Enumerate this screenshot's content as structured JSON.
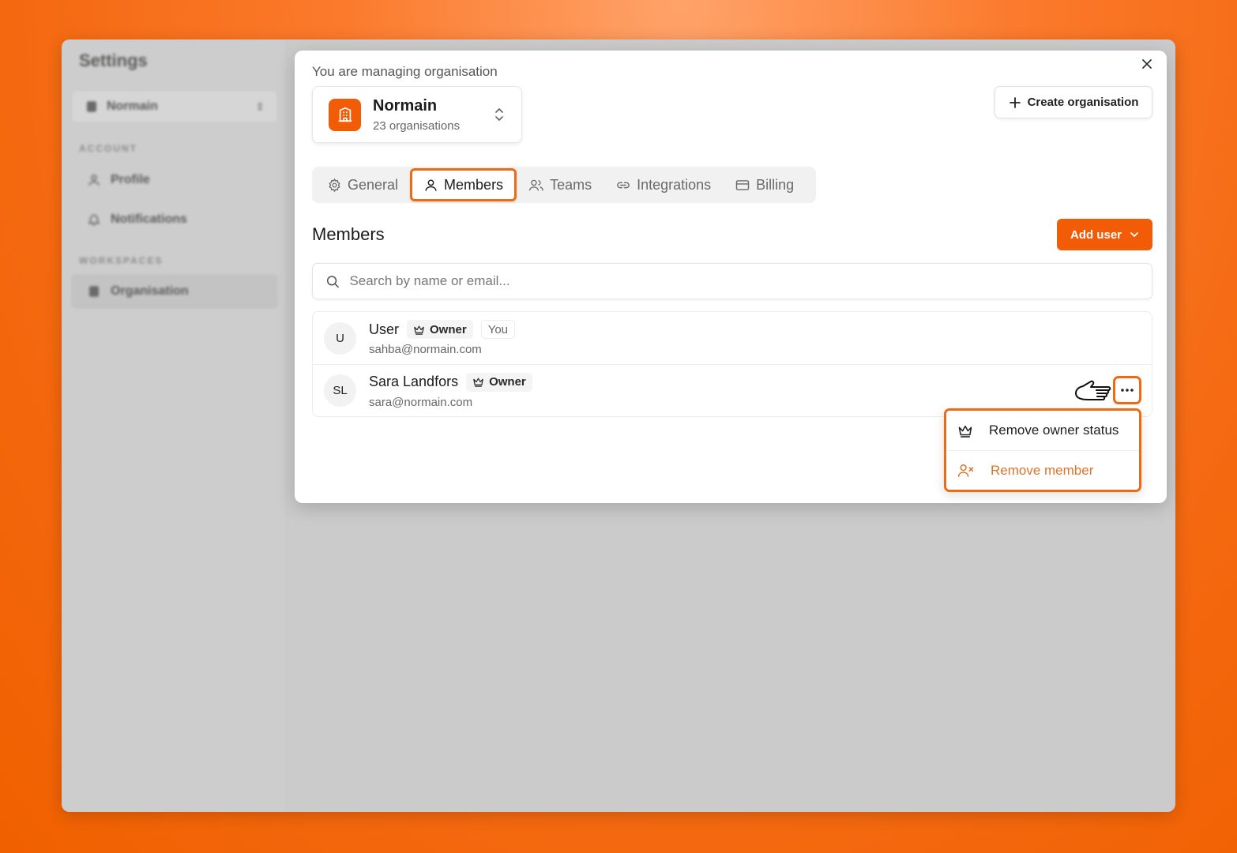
{
  "sidebar": {
    "title": "Settings",
    "org_selector": "Normain",
    "sections": [
      {
        "label": "ACCOUNT",
        "items": [
          {
            "label": "Profile",
            "icon": "user-icon"
          },
          {
            "label": "Notifications",
            "icon": "bell-icon"
          }
        ]
      },
      {
        "label": "WORKSPACES",
        "items": [
          {
            "label": "Organisation",
            "icon": "building-icon"
          }
        ]
      }
    ]
  },
  "modal": {
    "managing_label": "You are managing organisation",
    "org": {
      "name": "Normain",
      "count": "23 organisations"
    },
    "create_org_label": "Create organisation",
    "tabs": [
      {
        "label": "General",
        "icon": "gear-icon"
      },
      {
        "label": "Members",
        "icon": "user-icon",
        "active": true
      },
      {
        "label": "Teams",
        "icon": "users-icon"
      },
      {
        "label": "Integrations",
        "icon": "link-icon"
      },
      {
        "label": "Billing",
        "icon": "credit-card-icon"
      }
    ],
    "section_title": "Members",
    "add_user_label": "Add user",
    "search_placeholder": "Search by name or email...",
    "members": [
      {
        "initials": "U",
        "name": "User",
        "badge": "Owner",
        "tag": "You",
        "email": "sahba@normain.com"
      },
      {
        "initials": "SL",
        "name": "Sara Landfors",
        "badge": "Owner",
        "email": "sara@normain.com"
      }
    ],
    "menu": {
      "remove_owner": "Remove owner status",
      "remove_member": "Remove member"
    }
  },
  "colors": {
    "accent": "#f25c06",
    "accent_outline": "#f06a12",
    "danger_text": "#e0732a"
  }
}
